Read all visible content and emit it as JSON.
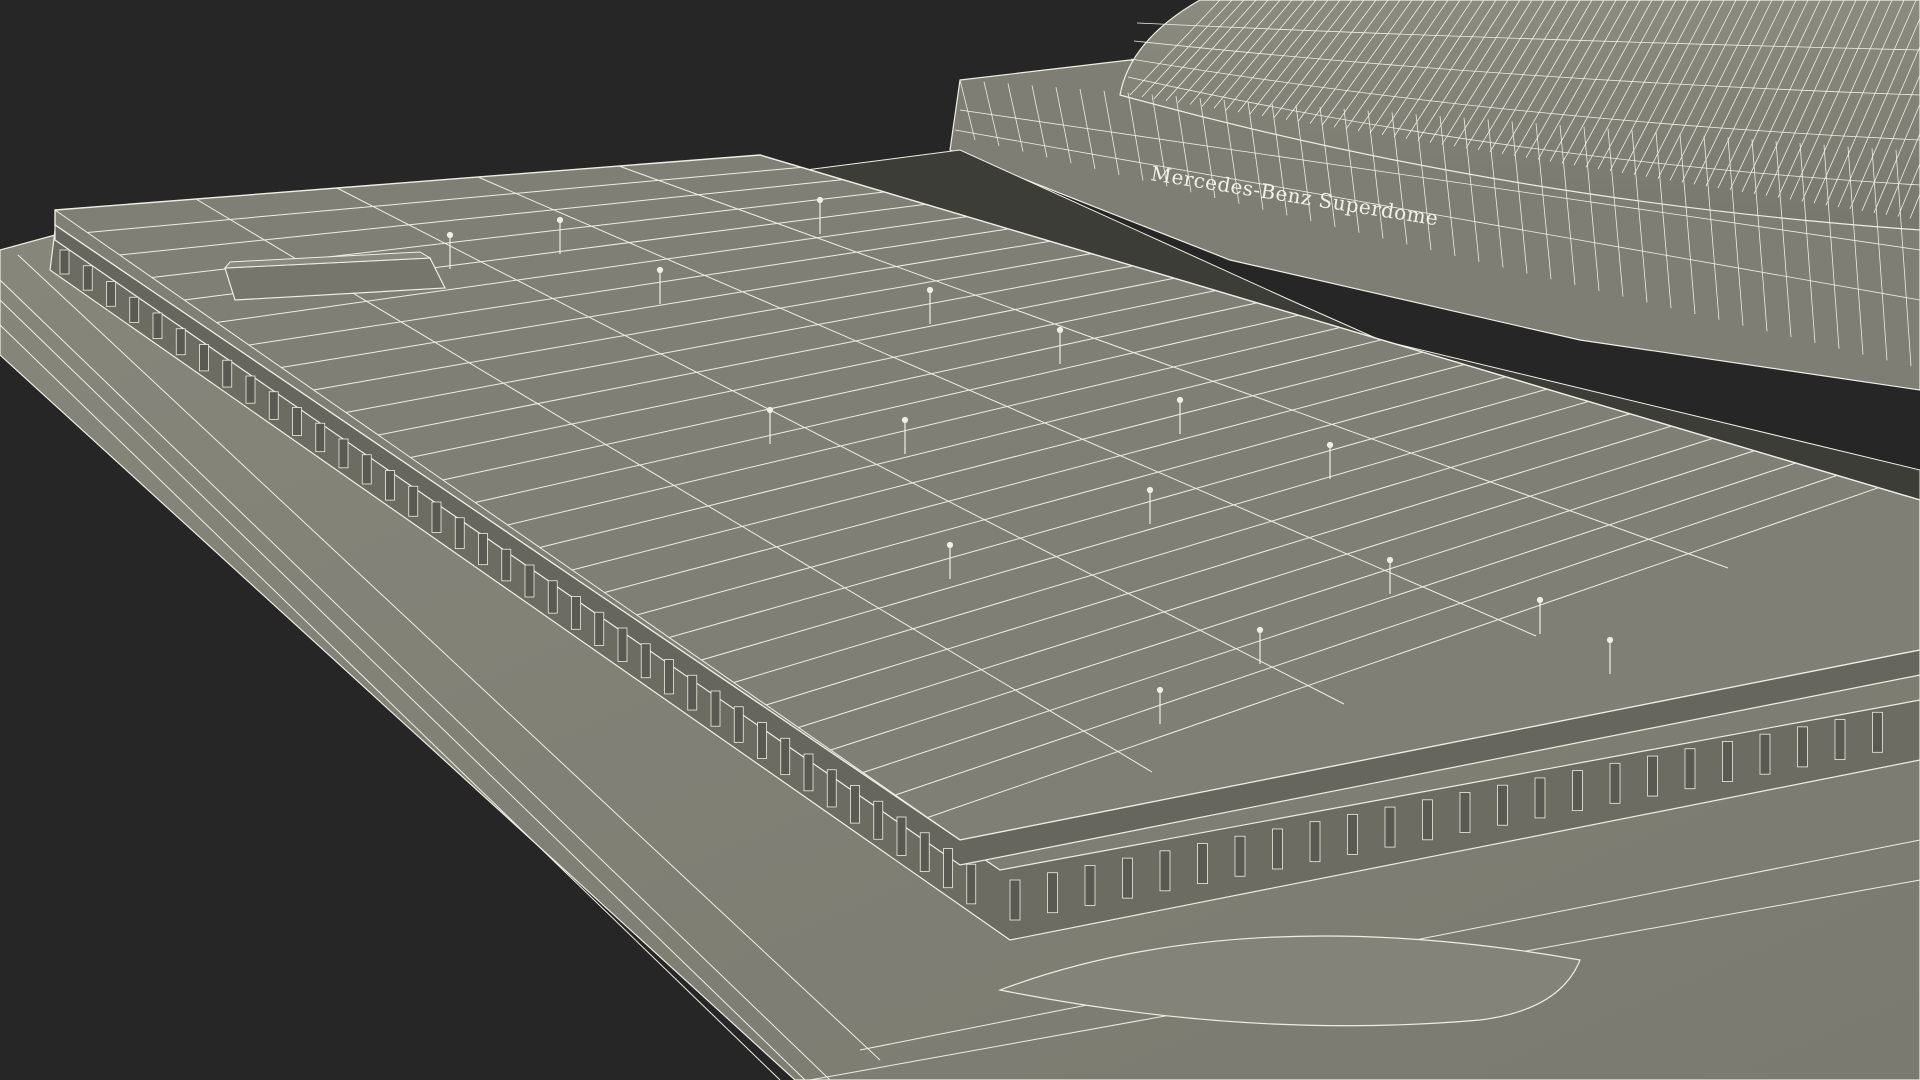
{
  "render": {
    "background_color": "#262626",
    "surface_color": "#7d7d72",
    "wire_color": "#eeeee4",
    "shadow_color": "#4e4e48"
  },
  "stadium": {
    "sign_text": "Mercedes-Benz Superdome"
  }
}
